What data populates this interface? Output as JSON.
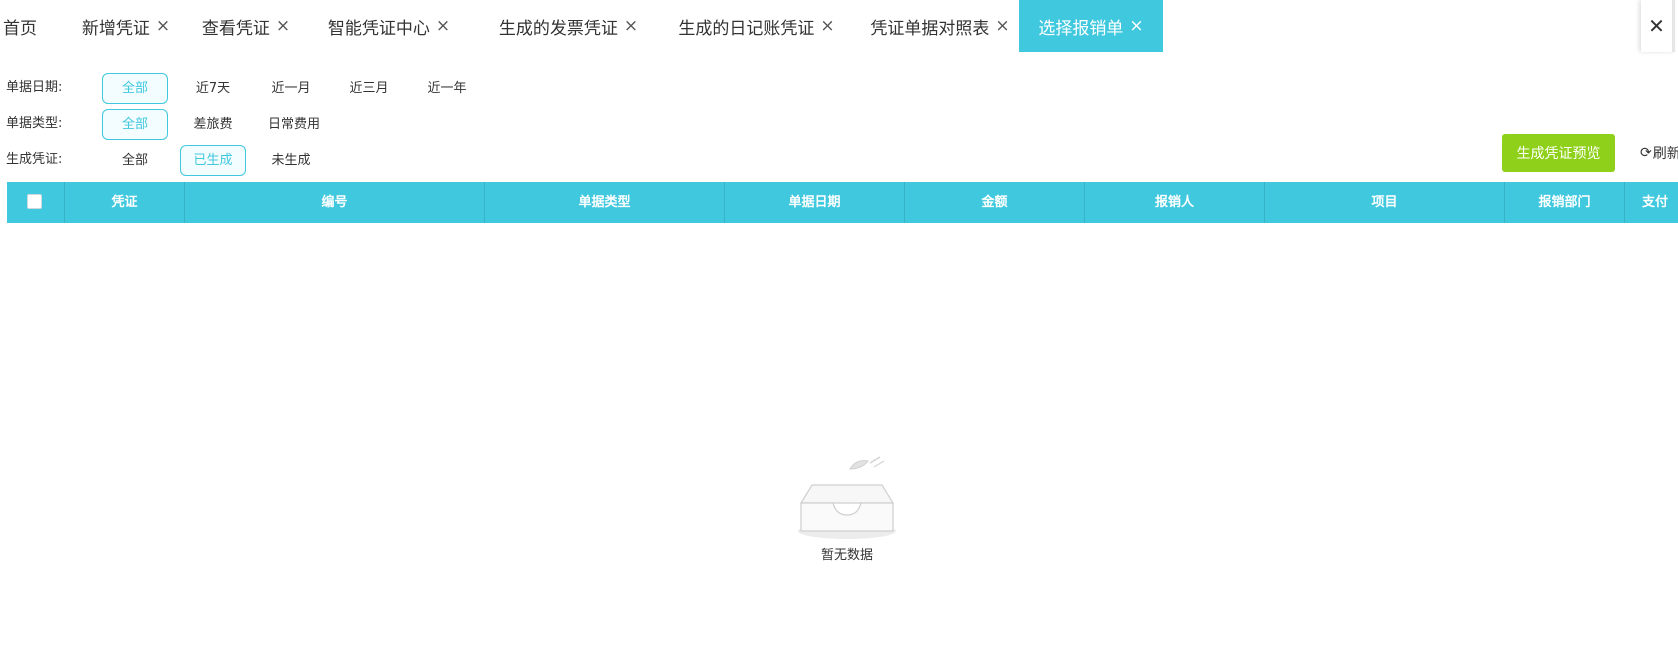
{
  "tabs": [
    {
      "label": "首页",
      "closable": false
    },
    {
      "label": "新增凭证",
      "closable": true
    },
    {
      "label": "查看凭证",
      "closable": true
    },
    {
      "label": "智能凭证中心",
      "closable": true
    },
    {
      "label": "生成的发票凭证",
      "closable": true
    },
    {
      "label": "生成的日记账凭证",
      "closable": true
    },
    {
      "label": "凭证单据对照表",
      "closable": true
    },
    {
      "label": "选择报销单",
      "closable": true,
      "active": true
    }
  ],
  "tab_close_symbol": "×",
  "close_all_symbol": "✕",
  "filters": {
    "date": {
      "label": "单据日期:",
      "options": [
        "全部",
        "近7天",
        "近一月",
        "近三月",
        "近一年"
      ],
      "selected": "全部"
    },
    "type": {
      "label": "单据类型:",
      "options": [
        "全部",
        "差旅费",
        "日常费用"
      ],
      "selected": "全部"
    },
    "voucher": {
      "label": "生成凭证:",
      "options": [
        "全部",
        "已生成",
        "未生成"
      ],
      "selected": "已生成"
    }
  },
  "actions": {
    "preview_label": "生成凭证预览",
    "refresh_label": "刷新",
    "refresh_icon": "refresh-icon"
  },
  "table": {
    "columns": [
      "凭证",
      "编号",
      "单据类型",
      "单据日期",
      "金额",
      "报销人",
      "项目",
      "报销部门",
      "支付"
    ],
    "rows": []
  },
  "empty_state": {
    "text": "暂无数据",
    "icon": "empty-box-icon"
  },
  "colors": {
    "accent": "#40c8de",
    "preview_button": "#8fd11a",
    "selected_option_bg": "#f3fcfe"
  }
}
